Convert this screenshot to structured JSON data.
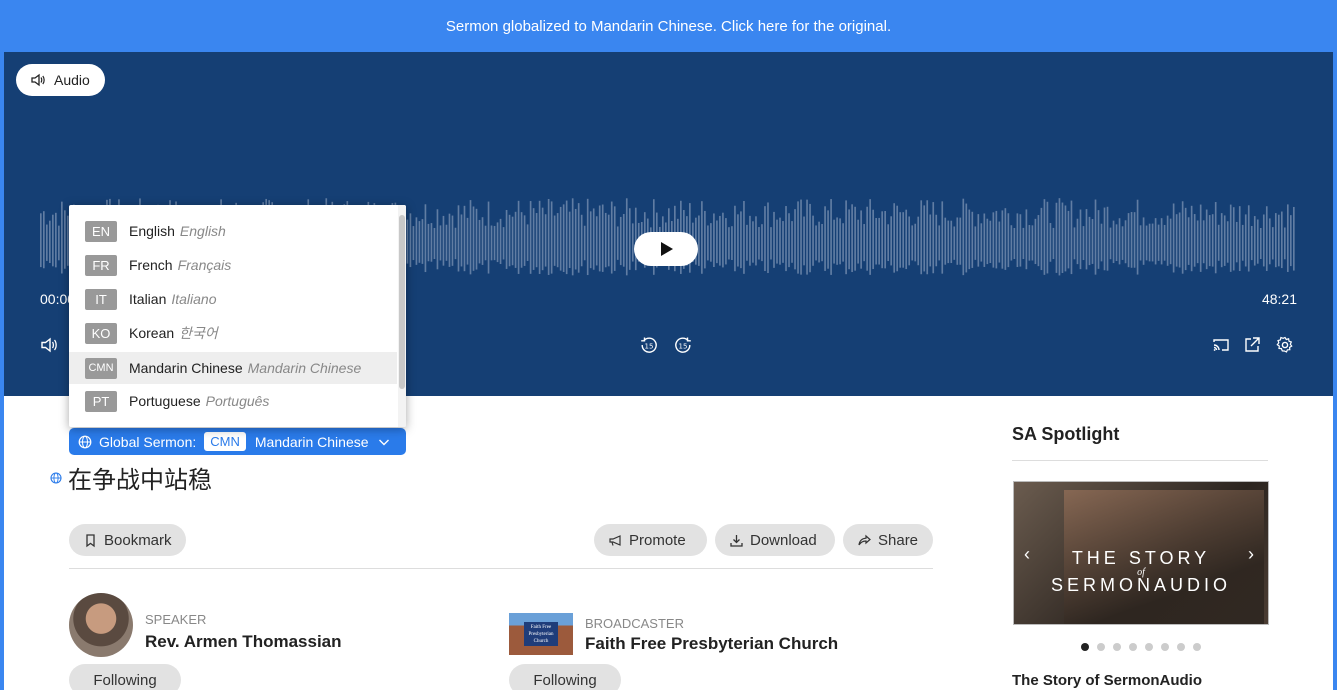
{
  "banner": {
    "text": "Sermon globalized to Mandarin Chinese. Click here for the original."
  },
  "player": {
    "audio_label": "Audio",
    "time_start": "00:00",
    "time_end": "48:21",
    "icons": [
      "speaker-icon",
      "play-icon",
      "rewind-15-icon",
      "forward-15-icon",
      "cast-icon",
      "external-link-icon",
      "gear-icon"
    ]
  },
  "language_menu": {
    "items": [
      {
        "code": "EN",
        "name": "English",
        "native": "English"
      },
      {
        "code": "FR",
        "name": "French",
        "native": "Français"
      },
      {
        "code": "IT",
        "name": "Italian",
        "native": "Italiano"
      },
      {
        "code": "KO",
        "name": "Korean",
        "native": "한국어"
      },
      {
        "code": "CMN",
        "name": "Mandarin Chinese",
        "native": "Mandarin Chinese",
        "selected": true
      },
      {
        "code": "PT",
        "name": "Portuguese",
        "native": "Português"
      }
    ]
  },
  "global_sermon": {
    "label": "Global Sermon:",
    "code": "CMN",
    "language": "Mandarin Chinese"
  },
  "sermon": {
    "title": "在争战中站稳"
  },
  "actions": {
    "bookmark": "Bookmark",
    "promote": "Promote",
    "download": "Download",
    "share": "Share"
  },
  "speaker": {
    "role": "SPEAKER",
    "name": "Rev. Armen Thomassian",
    "follow": "Following"
  },
  "broadcaster": {
    "role": "BROADCASTER",
    "name": "Faith Free Presbyterian Church",
    "follow": "Following",
    "sign_text": "Faith Free Presbyterian Church"
  },
  "spotlight": {
    "heading": "SA Spotlight",
    "card_line1": "THE STORY",
    "card_line2": "of",
    "card_line3": "SERMONAUDIO",
    "caption": "The Story of SermonAudio",
    "dot_count": 8,
    "active_dot": 0
  },
  "colors": {
    "banner": "#3a86f0",
    "player_bg": "#153f74",
    "accent": "#2a7bea"
  }
}
